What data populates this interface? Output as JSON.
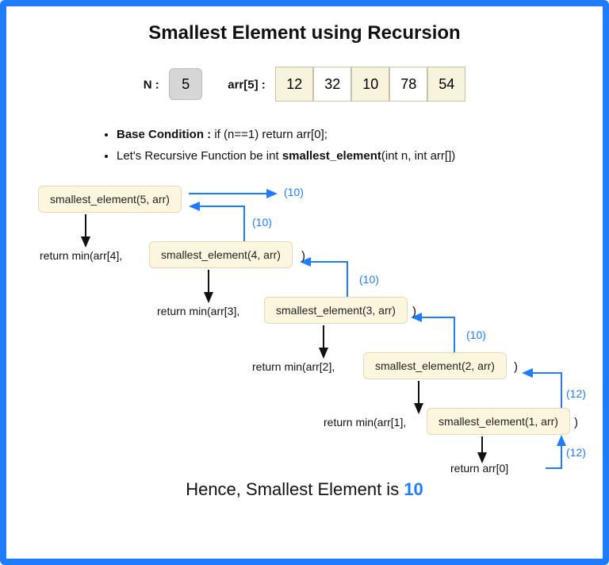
{
  "title": "Smallest Element using Recursion",
  "n_label": "N :",
  "n_value": "5",
  "arr_label": "arr[5] :",
  "arr": [
    "12",
    "32",
    "10",
    "78",
    "54"
  ],
  "bullets": {
    "base_label": "Base Condition :",
    "base_text": " if (n==1) return arr[0];",
    "fn_text": "Let's Recursive Function be int ",
    "fn_sig": "smallest_element",
    "fn_tail": "(int n, int arr[])"
  },
  "calls": {
    "c5": "smallest_element(5, arr)",
    "c4": "smallest_element(4, arr)",
    "c3": "smallest_element(3, arr)",
    "c2": "smallest_element(2, arr)",
    "c1": "smallest_element(1, arr)"
  },
  "returns": {
    "r4": "return min(arr[4],",
    "r3": "return min(arr[3],",
    "r2": "return min(arr[2],",
    "r1": "return min(arr[1],",
    "r0": "return arr[0]"
  },
  "vals": {
    "top": "(10)",
    "v5": "(10)",
    "v4": "(10)",
    "v3": "(10)",
    "v2": "(12)",
    "v1": "(12)"
  },
  "paren": ")",
  "conclusion_pre": "Hence, Smallest Element is ",
  "conclusion_ans": "10"
}
